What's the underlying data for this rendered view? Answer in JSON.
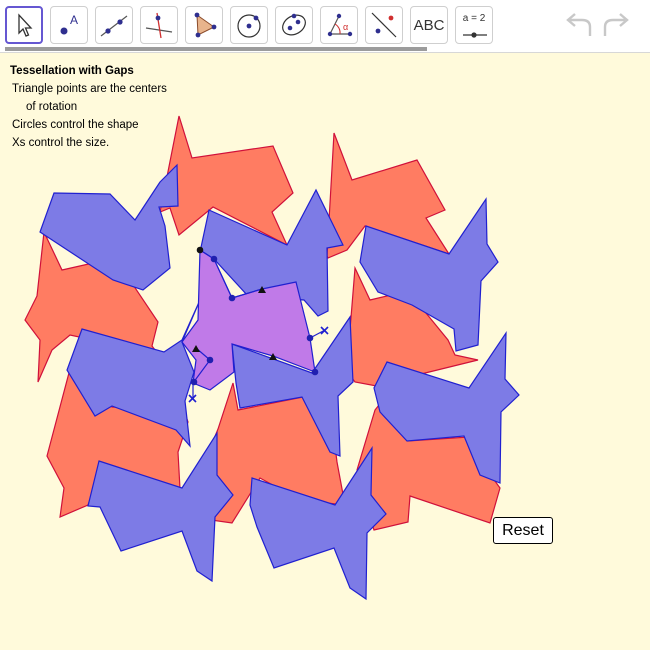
{
  "toolbar": {
    "tools": [
      {
        "name": "move-tool",
        "icon": "cursor-arrow-icon"
      },
      {
        "name": "point-tool",
        "icon": "point-label-icon",
        "label": "A"
      },
      {
        "name": "line-tool",
        "icon": "line-through-points-icon"
      },
      {
        "name": "perpendicular-tool",
        "icon": "perpendicular-line-icon"
      },
      {
        "name": "polygon-tool",
        "icon": "polygon-icon"
      },
      {
        "name": "circle-tool",
        "icon": "circle-center-point-icon"
      },
      {
        "name": "ellipse-tool",
        "icon": "ellipse-icon"
      },
      {
        "name": "angle-tool",
        "icon": "angle-icon",
        "label": "α"
      },
      {
        "name": "reflect-tool",
        "icon": "reflect-about-line-icon"
      },
      {
        "name": "text-tool",
        "icon": "text-icon",
        "label": "ABC"
      },
      {
        "name": "slider-tool",
        "icon": "slider-icon",
        "label": "a = 2"
      }
    ],
    "undo_icon": "undo-icon",
    "redo_icon": "redo-icon"
  },
  "canvas": {
    "title": "Tessellation with Gaps",
    "line1": "Triangle points are the centers",
    "line2": "of rotation",
    "line3": "Circles control the shape",
    "line4": "Xs control the size.",
    "reset_label": "Reset"
  },
  "colors": {
    "red_tile": "#ff7c62",
    "blue_tile": "#7d7be6",
    "center_tile": "#c07ae8",
    "background": "#fffadb",
    "accent": "#6557d2"
  }
}
